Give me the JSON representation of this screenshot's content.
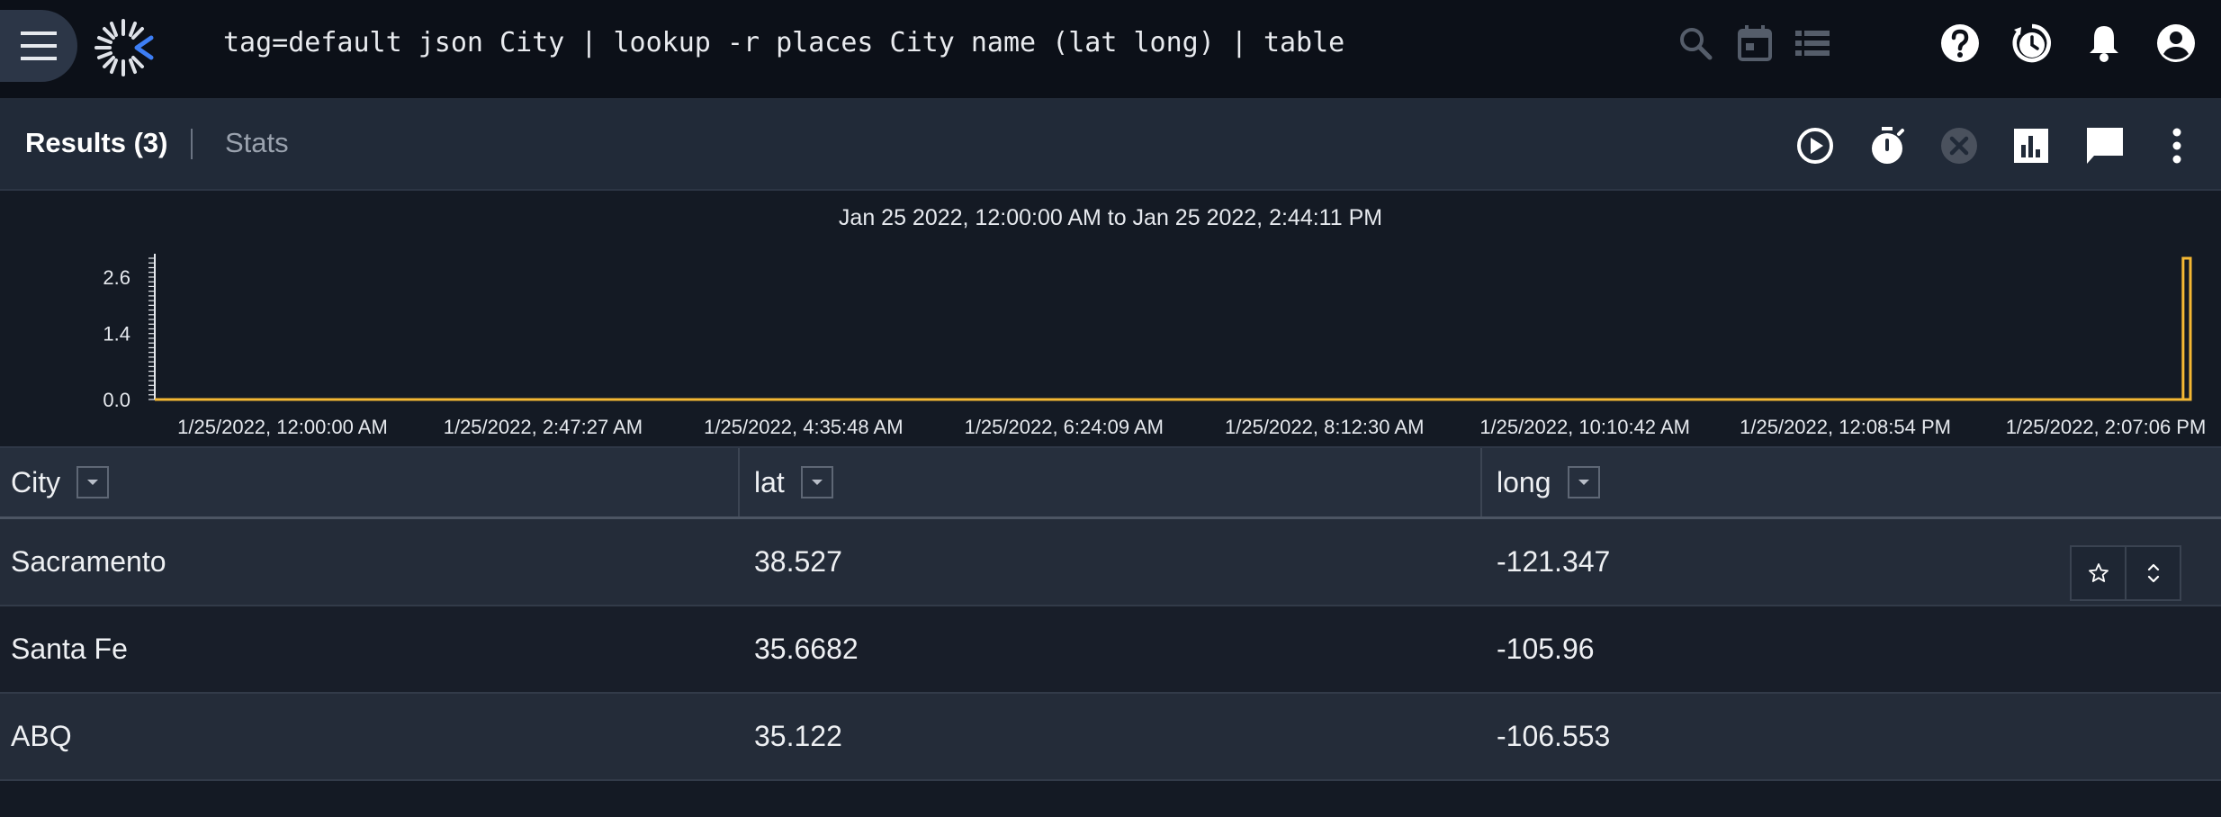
{
  "topbar": {
    "query": "tag=default json City | lookup -r places City name (lat long) | table",
    "icons": [
      "menu-icon",
      "logo",
      "search-icon",
      "calendar-icon",
      "list-icon",
      "help-icon",
      "history-icon",
      "bell-icon",
      "account-icon"
    ]
  },
  "results_bar": {
    "results_label": "Results (3)",
    "stats_label": "Stats",
    "icons": [
      "play-icon",
      "timer-icon",
      "cancel-icon",
      "bar-chart-icon",
      "comment-icon",
      "more-icon"
    ]
  },
  "chart_data": {
    "type": "bar",
    "title": "Jan 25 2022, 12:00:00 AM to Jan 25 2022, 2:44:11 PM",
    "xlabel": "",
    "ylabel": "",
    "x_tick_labels": [
      "1/25/2022, 12:00:00 AM",
      "1/25/2022, 2:47:27 AM",
      "1/25/2022, 4:35:48 AM",
      "1/25/2022, 6:24:09 AM",
      "1/25/2022, 8:12:30 AM",
      "1/25/2022, 10:10:42 AM",
      "1/25/2022, 12:08:54 PM",
      "1/25/2022, 2:07:06 PM"
    ],
    "y_tick_labels": [
      "0.0",
      "1.4",
      "2.6"
    ],
    "ylim": [
      0,
      3
    ],
    "x_range": [
      "1/25/2022, 12:00:00 AM",
      "1/25/2022, 2:44:11 PM"
    ],
    "series": [
      {
        "bars": [
          {
            "x_start": "1/25/2022, 2:41:00 PM",
            "x_end": "1/25/2022, 2:44:11 PM",
            "value": 3
          }
        ]
      }
    ],
    "bar_color": "#f5b833",
    "grid": false
  },
  "table": {
    "columns": [
      "City",
      "lat",
      "long"
    ],
    "rows": [
      [
        "Sacramento",
        "38.527",
        "-121.347"
      ],
      [
        "Santa Fe",
        "35.6682",
        "-105.96"
      ],
      [
        "ABQ",
        "35.122",
        "-106.553"
      ]
    ],
    "row_action_icons": [
      "star-icon",
      "expand-icon"
    ]
  },
  "colors": {
    "background": "#141a24",
    "topbar": "#0c1018",
    "accent_bar": "#f5b833",
    "logo_accent": "#3d7ef5"
  }
}
